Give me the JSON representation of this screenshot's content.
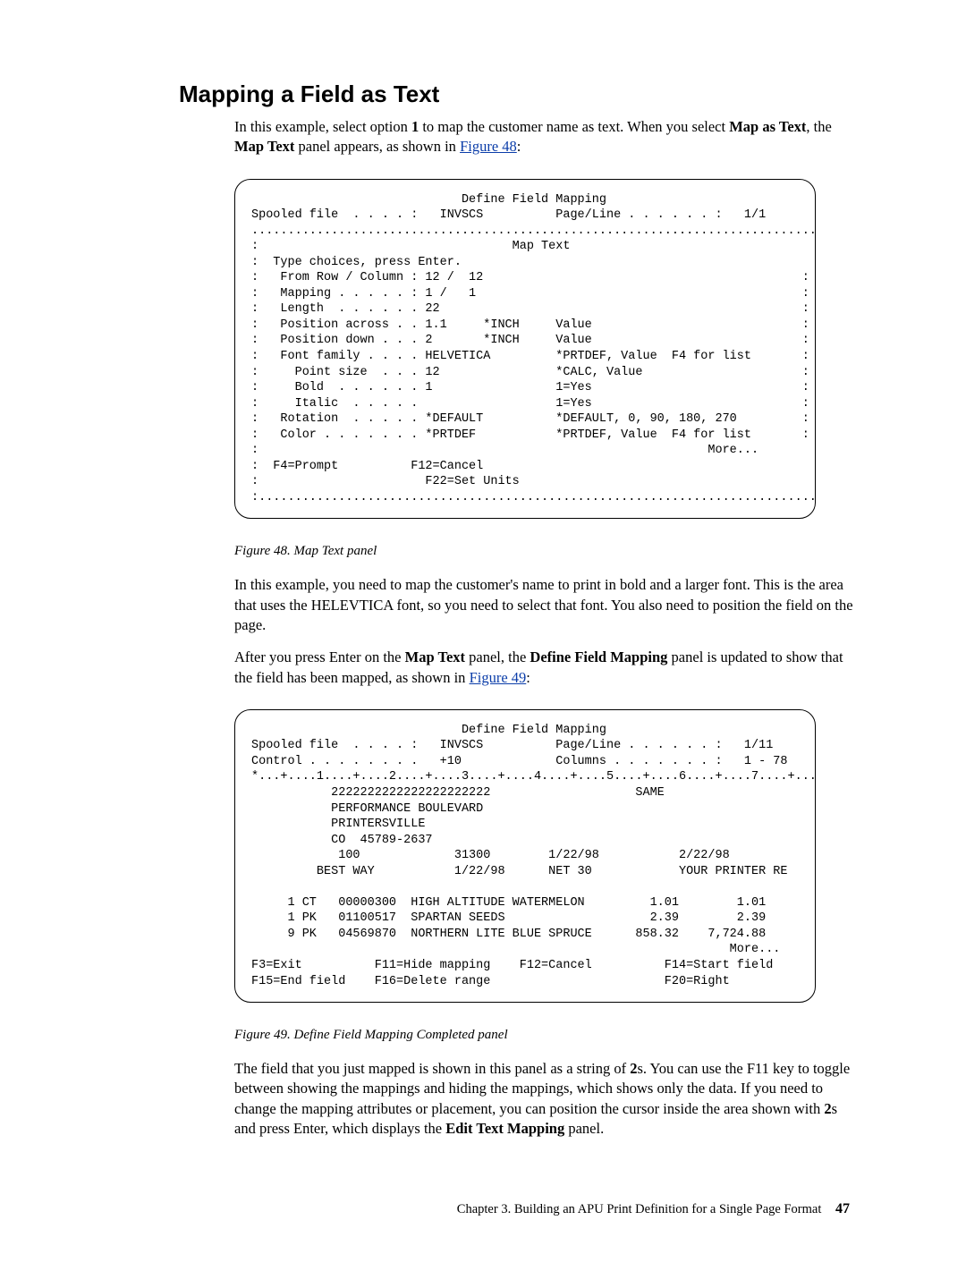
{
  "heading": "Mapping a Field as Text",
  "intro_html_parts": {
    "p1_a": "In this example, select option ",
    "p1_b": "1",
    "p1_c": " to map the customer name as text. When you select ",
    "p1_d": "Map as Text",
    "p1_e": ", the ",
    "p1_f": "Map Text",
    "p1_g": " panel appears, as shown in ",
    "p1_link": "Figure 48",
    "p1_h": ":"
  },
  "panel48": {
    "title": "Define Field Mapping",
    "status_left_label": "Spooled file  . . . . :",
    "status_left_value": "INVSCS",
    "status_right_label": "Page/Line . . . . . . :",
    "status_right_value": "1/1",
    "dots_top": "................................................................................",
    "sub_title": "Map Text",
    "prompt": "Type choices, press Enter.",
    "rows": [
      {
        "label": "From Row / Column :",
        "val": "12 /  12",
        "note": ""
      },
      {
        "label": "Mapping . . . . . :",
        "val": "1 /   1",
        "note": ""
      },
      {
        "label": "Length  . . . . . .",
        "val": "22",
        "note": ""
      },
      {
        "label": "Position across . .",
        "val": "1.1     *INCH",
        "note": "Value"
      },
      {
        "label": "Position down . . .",
        "val": "2       *INCH",
        "note": "Value"
      },
      {
        "label": "Font family . . . .",
        "val": "HELVETICA",
        "note": "*PRTDEF, Value  F4 for list"
      },
      {
        "label": "  Point size  . . .",
        "val": "12",
        "note": "*CALC, Value"
      },
      {
        "label": "  Bold  . . . . . .",
        "val": "1",
        "note": "1=Yes"
      },
      {
        "label": "  Italic  . . . . .",
        "val": "",
        "note": "1=Yes"
      },
      {
        "label": "Rotation  . . . . .",
        "val": "*DEFAULT",
        "note": "*DEFAULT, 0, 90, 180, 270"
      },
      {
        "label": "Color . . . . . . .",
        "val": "*PRTDEF",
        "note": "*PRTDEF, Value  F4 for list"
      }
    ],
    "more": "More...",
    "fkeys_l1": "F4=Prompt          F12=Cancel",
    "fkeys_l2": "F22=Set Units",
    "dots_bot": ":...............................................................................:"
  },
  "caption48_a": "Figure 48. Map Text panel",
  "mid_text": {
    "p2": "In this example, you need to map the customer's name to print in bold and a larger font. This is the area that uses the HELEVTICA font, so you need to select that font. You also need to position the field on the page.",
    "p3_a": "After you press Enter on the ",
    "p3_b": "Map Text",
    "p3_c": " panel, the ",
    "p3_d": "Define Field Mapping",
    "p3_e": " panel is updated to show that the field has been mapped, as shown in ",
    "p3_link": "Figure 49",
    "p3_f": ":"
  },
  "panel49": {
    "title": "Define Field Mapping",
    "l1_left_label": "Spooled file  . . . . :",
    "l1_left_value": "INVSCS",
    "l1_right_label": "Page/Line . . . . . . :",
    "l1_right_value": "1/11",
    "l2_left_label": "Control . . . . . . . .",
    "l2_left_value": "+10",
    "l2_right_label": "Columns . . . . . . . :",
    "l2_right_value": "1 - 78",
    "ruler": "*...+....1....+....2....+....3....+....4....+....5....+....6....+....7....+...",
    "mapstr": "2222222222222222222222",
    "same": "SAME",
    "addr1": "PERFORMANCE BOULEVARD",
    "addr2": "PRINTERSVILLE",
    "addr3": "CO  45789-2637",
    "row_a": "            100             31300        1/22/98           2/22/98",
    "row_b": "         BEST WAY           1/22/98      NET 30            YOUR PRINTER RE",
    "items": [
      "     1 CT   00000300  HIGH ALTITUDE WATERMELON         1.01        1.01",
      "     1 PK   01100517  SPARTAN SEEDS                    2.39        2.39",
      "     9 PK   04569870  NORTHERN LITE BLUE SPRUCE      858.32    7,724.88"
    ],
    "more": "More...",
    "fkeys1": "F3=Exit          F11=Hide mapping    F12=Cancel          F14=Start field",
    "fkeys2": "F15=End field    F16=Delete range                        F20=Right"
  },
  "caption49_a": "Figure 49. Define Field Mapping Completed panel",
  "end_text": {
    "p4_a": "The field that you just mapped is shown in this panel as a string of ",
    "p4_b": "2",
    "p4_c": "s. You can use the F11 key to toggle between showing the mappings and hiding the mappings, which shows only the data. If you need to change the mapping attributes or placement, you can position the cursor inside the area shown with ",
    "p4_d": "2",
    "p4_e": "s and press Enter, which displays the ",
    "p4_f": "Edit Text Mapping",
    "p4_g": " panel."
  },
  "footer_text": "Chapter 3. Building an APU Print Definition for a Single Page Format",
  "footer_page": "47"
}
